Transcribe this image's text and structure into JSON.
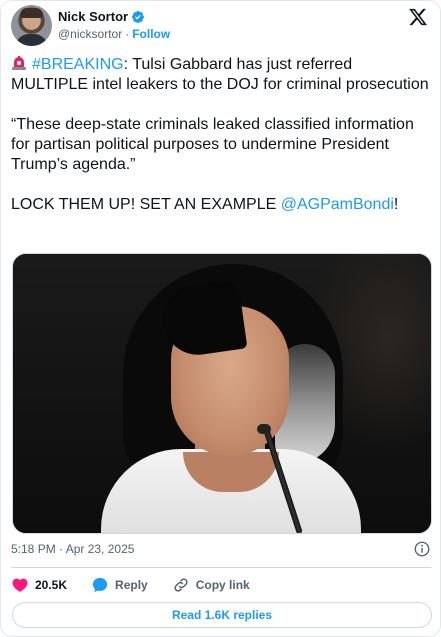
{
  "author": {
    "display_name": "Nick Sortor",
    "handle": "@nicksortor",
    "separator": "·",
    "follow_label": "Follow",
    "verified": true
  },
  "icons": {
    "avatar": "avatar",
    "verified": "verified-badge-icon",
    "platform_logo": "x-logo-icon",
    "siren": "police-siren-icon",
    "info": "info-icon",
    "like": "heart-icon",
    "reply": "speech-bubble-icon",
    "copy_link": "link-icon"
  },
  "tweet": {
    "line1": {
      "hashtag": "#BREAKING",
      "rest": ": Tulsi Gabbard has just referred MULTIPLE intel leakers to the DOJ for criminal prosecution"
    },
    "quote": "“These deep-state criminals leaked classified information for partisan political purposes to undermine President Trump’s agenda.”",
    "line3": {
      "text": "LOCK THEM UP! SET AN EXAMPLE ",
      "mention": "@AGPamBondi",
      "suffix": "!"
    }
  },
  "timestamp": "5:18 PM · Apr 23, 2025",
  "actions": {
    "like_count": "20.5K",
    "reply_label": "Reply",
    "copy_link_label": "Copy link"
  },
  "read_replies_label": "Read 1.6K replies",
  "colors": {
    "accent": "#1d9bf0",
    "text": "#0f1419",
    "muted": "#536471",
    "like": "#f91880",
    "border": "#cfd9de"
  }
}
